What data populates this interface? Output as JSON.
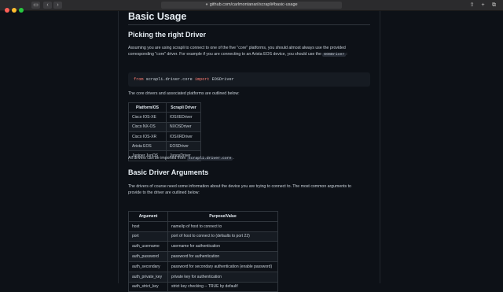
{
  "browser": {
    "url": "github.com/carlmontanari/scrapli#basic-usage",
    "back_glyph": "‹",
    "forward_glyph": "›",
    "sidebar_glyph": "▭"
  },
  "colors": {
    "close": "#ff5f57",
    "minimize": "#febc2e",
    "maximize": "#28c840",
    "keyword": "#ff7b72"
  },
  "doc": {
    "h1": "Basic Usage",
    "picking": {
      "heading": "Picking the right Driver",
      "para_1": "Assuming you are using scrapli to connect to one of the five \"core\" platforms, you should almost always use the provided",
      "para_2_pre": "corresponding \"core\" driver. For example if you are connecting to an Arista EOS device, you should use the",
      "para_2_code": "EOSDriver",
      "para_2_post": ":",
      "code": {
        "kw_from": "from",
        "module": "scrapli.driver.core",
        "kw_import": "import",
        "name": "EOSDriver"
      },
      "para_3": "The core drivers and associated platforms are outlined below:"
    },
    "drivers_table": {
      "headers": [
        "Platform/OS",
        "Scrapli Driver"
      ],
      "rows": [
        [
          "Cisco IOS-XE",
          "IOSXEDriver"
        ],
        [
          "Cisco NX-OS",
          "NXOSDriver"
        ],
        [
          "Cisco IOS-XR",
          "IOSXRDriver"
        ],
        [
          "Arista EOS",
          "EOSDriver"
        ],
        [
          "Juniper JunOS",
          "JunosDriver"
        ]
      ]
    },
    "import_note": {
      "pre": "All drivers can be imported from",
      "code": "scrapli.driver.core",
      "post": "."
    },
    "args": {
      "heading": "Basic Driver Arguments",
      "para_1": "The drivers of course need some information about the device you are trying to connect to. The most common arguments to",
      "para_2": "provide to the driver are outlined below:"
    },
    "args_table": {
      "headers": [
        "Argument",
        "Purpose/Value"
      ],
      "rows": [
        [
          "host",
          "name/ip of host to connect to"
        ],
        [
          "port",
          "port of host to connect to (defaults to port 22)"
        ],
        [
          "auth_username",
          "username for authentication"
        ],
        [
          "auth_password",
          "password for authentication"
        ],
        [
          "auth_secondary",
          "password for secondary authentication (enable password)"
        ],
        [
          "auth_private_key",
          "private key for authentication"
        ],
        [
          "auth_strict_key",
          "strict key checking -- TRUE by default!"
        ]
      ]
    }
  }
}
